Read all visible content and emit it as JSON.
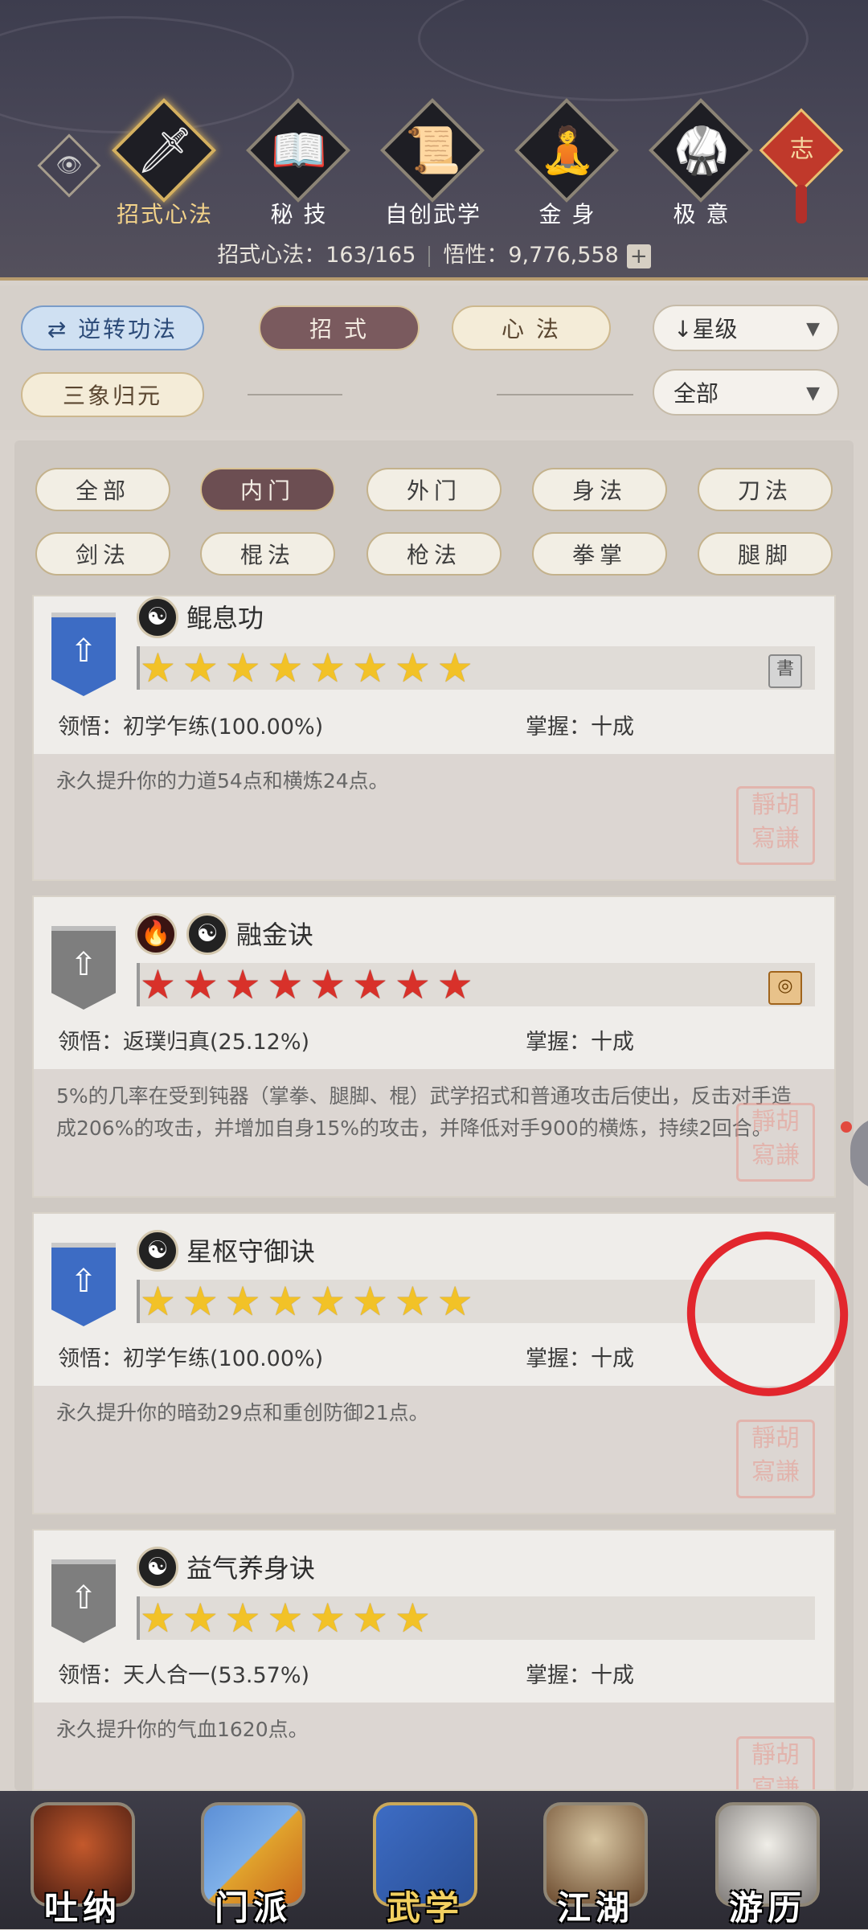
{
  "header": {
    "eye_icon": "eye-icon",
    "tabs": [
      {
        "label": "招式心法",
        "icon": "sword-icon",
        "glyph": "🗡"
      },
      {
        "label": "秘 技",
        "icon": "book-icon",
        "glyph": "📖"
      },
      {
        "label": "自创武学",
        "icon": "scroll-icon",
        "glyph": "📜"
      },
      {
        "label": "金 身",
        "icon": "meditation-icon",
        "glyph": "🧘"
      },
      {
        "label": "极 意",
        "icon": "martial-stance-icon",
        "glyph": "🥋"
      }
    ],
    "knot_label": "志",
    "stats": {
      "label": "招式心法：163/165",
      "insight": "悟性：9,776,558",
      "plus": "+"
    }
  },
  "filters": {
    "reverse_button": "逆转功法",
    "zhaoshi_tab": "招 式",
    "xinfa_tab": "心 法",
    "sanxiang_button": "三象归元",
    "sort_dropdown": "星级",
    "scope_dropdown": "全部"
  },
  "categories": [
    "全部",
    "内门",
    "外门",
    "身法",
    "刀法",
    "剑法",
    "棍法",
    "枪法",
    "拳掌",
    "腿脚"
  ],
  "skills": [
    {
      "name": "鲲息功",
      "stars": 8,
      "star_color": "gold",
      "comprehension": "领悟：初学乍练(100.00%)",
      "mastery": "掌握：十成",
      "description": "永久提升你的力道54点和横炼24点。"
    },
    {
      "name": "融金诀",
      "stars": 8,
      "star_color": "red",
      "comprehension": "领悟：返璞归真(25.12%)",
      "mastery": "掌握：十成",
      "description": "5%的几率在受到钝器（掌拳、腿脚、棍）武学招式和普通攻击后使出，反击对手造成206%的攻击，并增加自身15%的攻击，并降低对手900的横炼，持续2回合。"
    },
    {
      "name": "星枢守御诀",
      "stars": 8,
      "star_color": "gold",
      "comprehension": "领悟：初学乍练(100.00%)",
      "mastery": "掌握：十成",
      "description": "永久提升你的暗劲29点和重创防御21点。"
    },
    {
      "name": "益气养身诀",
      "stars": 7,
      "star_color": "gold",
      "comprehension": "领悟：天人合一(53.57%)",
      "mastery": "掌握：十成",
      "description": "永久提升你的气血1620点。"
    }
  ],
  "nav": [
    "吐纳",
    "门派",
    "武学",
    "江湖",
    "游历"
  ]
}
